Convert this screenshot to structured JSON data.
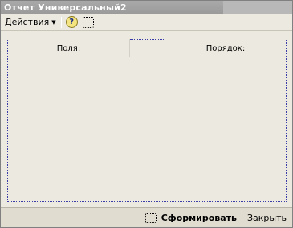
{
  "window": {
    "title": "Отчет Универсальный2"
  },
  "toolbar": {
    "actions_label": "Действия",
    "help_glyph": "?",
    "help_icon": "help-icon",
    "select_icon": "selection-icon"
  },
  "fields_table": {
    "columns": [
      "Поля:",
      "",
      "Порядок:"
    ]
  },
  "footer": {
    "form_label": "Сформировать",
    "close_label": "Закрыть"
  }
}
